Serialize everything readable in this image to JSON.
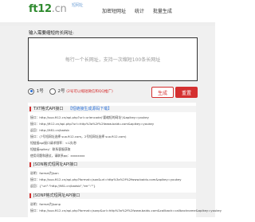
{
  "header": {
    "logo_main": "ft12",
    "logo_tld": ".cn",
    "logo_sub": "短网址",
    "nav": [
      "加密短网址",
      "统计",
      "批量生成"
    ]
  },
  "panel": {
    "title": "输入需要缩短的长网址:",
    "textbox_placeholder": "每行一个长网址，支持一次缩短100条长网址",
    "option1": "1号",
    "option2": "2号",
    "option2_note": "(2号可以缩短微信和QQ推广)",
    "generate_label": "生成",
    "reset_label": "重置"
  },
  "api1": {
    "title": "TXT格式API接口",
    "link": "【短链接生成源码下载】",
    "lines": [
      "接口：http://suo.ft12.cn/api.php?url=urlencode('要缩短的网址')&apikey=youkey",
      "接口：http://ft12.cn/api.php?url=http%3a%2f%2fwww.baidu.com&apikey=youkey",
      "返回：http://981.cn/badsb",
      "接口：(7号短网址选择 suo.ft12.com，2号短网址选择 suo.ft12.com)",
      "短链接api接口请求频率：<1次/秒",
      "短链接apikey：联系客服获取",
      "使用问题和建议，请联系qq：xxxxxxxx"
    ]
  },
  "api2": {
    "title": "JSON格式短网址API接口",
    "lines": [
      "说明：format为json",
      "接口：http://suo.ft12.cn/api.php?format=json&url=http%3a%2f%2fwww.baidu.com&apikey=youkey",
      "返回：{\"url\":\"http://981.cn/badsb\",\"err\":\"\"}"
    ]
  },
  "api3": {
    "title": "JSONP格式短网址API接口",
    "lines": [
      "说明：format为jsonp",
      "接口：http://suo.ft12.cn/api.php?format=jsonp&url=http%3a%2f%2fwww.baidu.com&callback=callbackname&apikey=youkey"
    ]
  }
}
